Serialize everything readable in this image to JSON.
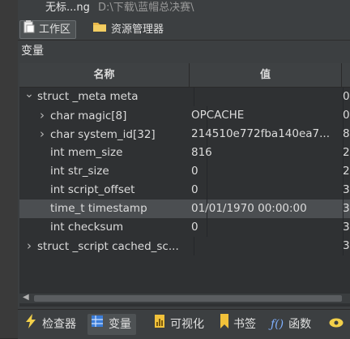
{
  "recent": {
    "name": "无标...ng",
    "path": "D:\\下载\\蓝帽总决赛\\"
  },
  "tabs": [
    {
      "label": "工作区",
      "icon": "clipboard-icon"
    },
    {
      "label": "资源管理器",
      "icon": "folder-icon"
    }
  ],
  "panel_title": "变量",
  "table": {
    "headers": [
      "名称",
      "值"
    ],
    "rows": [
      {
        "name": "struct _meta meta",
        "value": "",
        "extra": "0",
        "caret": "v"
      },
      {
        "name": "char magic[8]",
        "value": "OPCACHE",
        "extra": "0",
        "caret": ">"
      },
      {
        "name": "char system_id[32]",
        "value": "214510e772fba140ea7...",
        "extra": "8",
        "caret": ">"
      },
      {
        "name": "int mem_size",
        "value": "816",
        "extra": "2",
        "caret": ""
      },
      {
        "name": "int str_size",
        "value": "0",
        "extra": "2",
        "caret": ""
      },
      {
        "name": "int script_offset",
        "value": "0",
        "extra": "3",
        "caret": ""
      },
      {
        "name": "time_t timestamp",
        "value": "01/01/1970 00:00:00",
        "extra": "3",
        "caret": ""
      },
      {
        "name": "int checksum",
        "value": "0",
        "extra": "3",
        "caret": ""
      },
      {
        "name": "struct _script cached_sc...",
        "value": "",
        "extra": "3",
        "caret": ">"
      }
    ]
  },
  "bottom_tabs": [
    {
      "label": "检查器",
      "icon": "lightning-icon"
    },
    {
      "label": "变量",
      "icon": "grid-icon"
    },
    {
      "label": "可视化",
      "icon": "chart-icon"
    },
    {
      "label": "书签",
      "icon": "bookmark-icon"
    },
    {
      "label": "函数",
      "icon": "function-icon"
    },
    {
      "label": "",
      "icon": "eye-icon"
    }
  ]
}
